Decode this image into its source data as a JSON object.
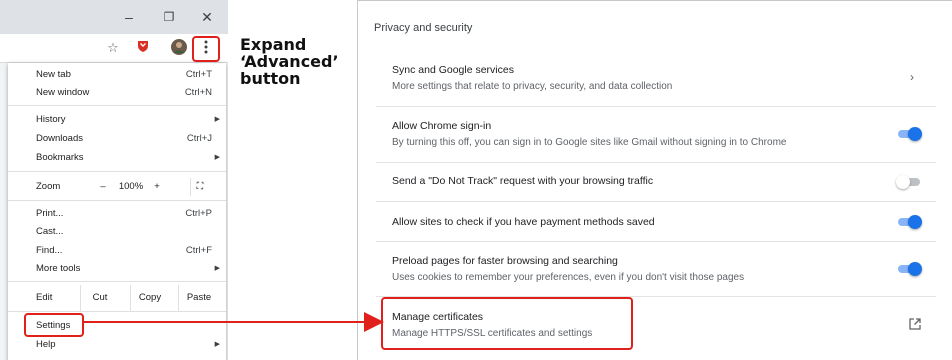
{
  "window_controls": {
    "minimize": "–",
    "restore": "❐",
    "close": "✕"
  },
  "toolbar_icons": [
    "star-icon",
    "extension-shield-icon",
    "profile-avatar-icon",
    "kebab-menu-icon"
  ],
  "menu": {
    "new_tab": {
      "label": "New tab",
      "shortcut": "Ctrl+T"
    },
    "new_window": {
      "label": "New window",
      "shortcut": "Ctrl+N"
    },
    "history": {
      "label": "History"
    },
    "downloads": {
      "label": "Downloads",
      "shortcut": "Ctrl+J"
    },
    "bookmarks": {
      "label": "Bookmarks"
    },
    "zoom": {
      "label": "Zoom",
      "minus": "–",
      "value": "100%",
      "plus": "+",
      "fullscreen": "⛶"
    },
    "print": {
      "label": "Print...",
      "shortcut": "Ctrl+P"
    },
    "cast": {
      "label": "Cast..."
    },
    "find": {
      "label": "Find...",
      "shortcut": "Ctrl+F"
    },
    "more_tools": {
      "label": "More tools"
    },
    "edit": {
      "label": "Edit",
      "cut": "Cut",
      "copy": "Copy",
      "paste": "Paste"
    },
    "settings": {
      "label": "Settings"
    },
    "help": {
      "label": "Help"
    }
  },
  "annotation": {
    "line1": "Expand",
    "line2": "‘Advanced’",
    "line3": "button"
  },
  "privacy": {
    "title": "Privacy and security",
    "rows": [
      {
        "title": "Sync and Google services",
        "desc": "More settings that relate to privacy, security, and data collection",
        "control": "chevron"
      },
      {
        "title": "Allow Chrome sign-in",
        "desc": "By turning this off, you can sign in to Google sites like Gmail without signing in to Chrome",
        "control": "toggle",
        "on": true
      },
      {
        "title": "Send a \"Do Not Track\" request with your browsing traffic",
        "desc": "",
        "control": "toggle",
        "on": false
      },
      {
        "title": "Allow sites to check if you have payment methods saved",
        "desc": "",
        "control": "toggle",
        "on": true
      },
      {
        "title": "Preload pages for faster browsing and searching",
        "desc": "Uses cookies to remember your preferences, even if you don't visit those pages",
        "control": "toggle",
        "on": true
      },
      {
        "title": "Manage certificates",
        "desc": "Manage HTTPS/SSL certificates and settings",
        "control": "external-link"
      }
    ]
  },
  "colors": {
    "highlight": "#e0201b",
    "toggle_on": "#1a73e8",
    "toggle_on_track": "#8ab4f8"
  }
}
